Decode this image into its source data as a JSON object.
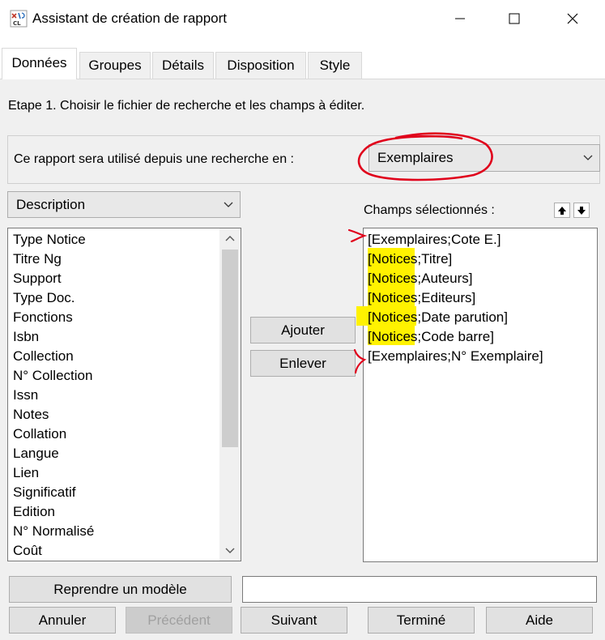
{
  "window": {
    "title": "Assistant de création de rapport",
    "icon": "report-wizard-icon",
    "minimize_glyph": "—",
    "maximize_glyph": "☐",
    "close_glyph": "✕"
  },
  "tabs": [
    {
      "label": "Données",
      "active": true
    },
    {
      "label": "Groupes",
      "active": false
    },
    {
      "label": "Détails",
      "active": false
    },
    {
      "label": "Disposition",
      "active": false
    },
    {
      "label": "Style",
      "active": false
    }
  ],
  "step": {
    "text": "Etape 1. Choisir le fichier de recherche et les champs à éditer."
  },
  "source": {
    "label": "Ce rapport sera utilisé depuis une recherche en :",
    "selected": "Exemplaires"
  },
  "field_category": {
    "selected": "Description"
  },
  "available_fields": [
    "Type Notice",
    "Titre Ng",
    "Support",
    "Type Doc.",
    "Fonctions",
    "Isbn",
    "Collection",
    "N° Collection",
    "Issn",
    "Notes",
    "Collation",
    "Langue",
    "Lien",
    "Significatif",
    "Edition",
    "N° Normalisé",
    "Coût"
  ],
  "actions": {
    "add_label": "Ajouter",
    "remove_label": "Enlever"
  },
  "selected_fields": {
    "label": "Champs sélectionnés :",
    "items": [
      {
        "table": "Exemplaires",
        "field": "Cote E."
      },
      {
        "table": "Notices",
        "field": "Titre"
      },
      {
        "table": "Notices",
        "field": "Auteurs"
      },
      {
        "table": "Notices",
        "field": "Editeurs"
      },
      {
        "table": "Notices",
        "field": "Date parution"
      },
      {
        "table": "Notices",
        "field": "Code barre"
      },
      {
        "table": "Exemplaires",
        "field": "N° Exemplaire"
      }
    ]
  },
  "template": {
    "button_label": "Reprendre un modèle",
    "value": ""
  },
  "footer": {
    "cancel": "Annuler",
    "previous": "Précédent",
    "next": "Suivant",
    "finish": "Terminé",
    "help": "Aide"
  },
  "colors": {
    "highlight": "#fff200",
    "annotation": "#e0001b",
    "dialog_bg": "#f0f0f0"
  }
}
